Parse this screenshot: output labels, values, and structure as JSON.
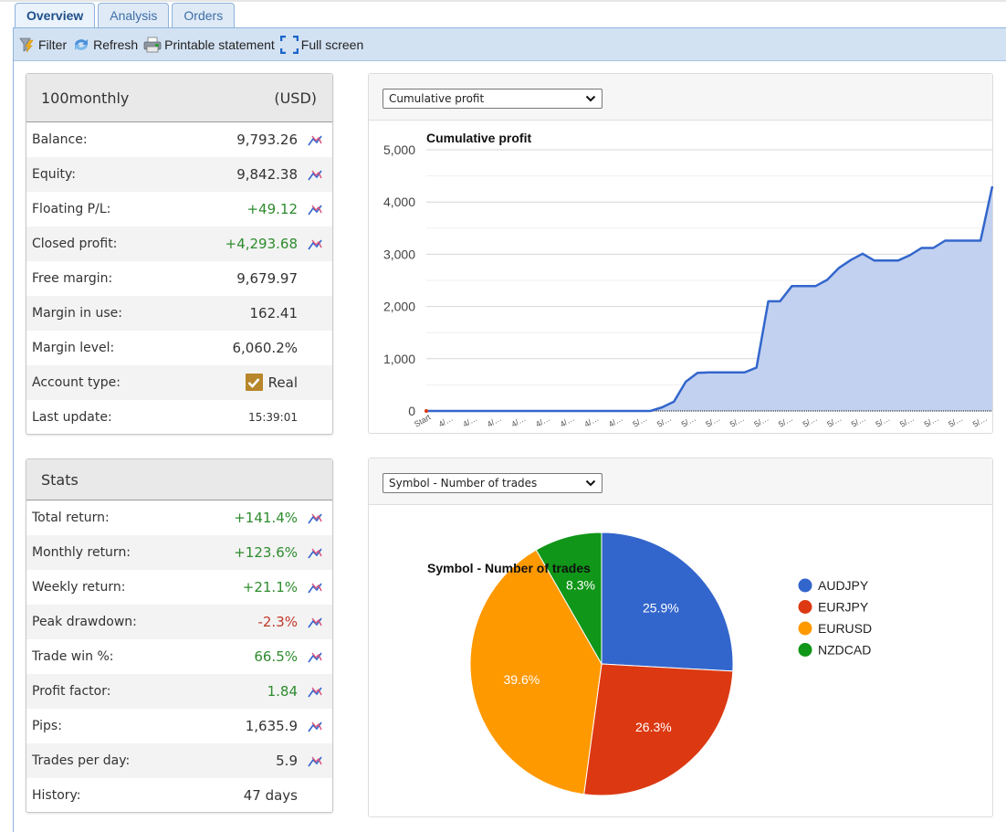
{
  "tabs": [
    {
      "label": "Overview",
      "active": true
    },
    {
      "label": "Analysis",
      "active": false
    },
    {
      "label": "Orders",
      "active": false
    }
  ],
  "toolbar": {
    "filter": {
      "label": "Filter",
      "icon": "filter-icon"
    },
    "refresh": {
      "label": "Refresh",
      "icon": "refresh-icon"
    },
    "print": {
      "label": "Printable statement",
      "icon": "printer-icon"
    },
    "fullscreen": {
      "label": "Full screen",
      "icon": "fullscreen-icon"
    }
  },
  "account": {
    "name": "100monthly",
    "currency": "(USD)",
    "rows": [
      {
        "label": "Balance:",
        "value": "9,793.26",
        "tone": "",
        "chart_icon": true
      },
      {
        "label": "Equity:",
        "value": "9,842.38",
        "tone": "",
        "chart_icon": true
      },
      {
        "label": "Floating P/L:",
        "value": "+49.12",
        "tone": "pos",
        "chart_icon": true
      },
      {
        "label": "Closed profit:",
        "value": "+4,293.68",
        "tone": "pos",
        "chart_icon": true
      },
      {
        "label": "Free margin:",
        "value": "9,679.97",
        "tone": "",
        "chart_icon": false
      },
      {
        "label": "Margin in use:",
        "value": "162.41",
        "tone": "",
        "chart_icon": false
      },
      {
        "label": "Margin level:",
        "value": "6,060.2%",
        "tone": "",
        "chart_icon": false
      },
      {
        "label": "Account type:",
        "value": "Real",
        "tone": "",
        "chart_icon": false,
        "checked": true
      },
      {
        "label": "Last update:",
        "value": "15:39:01",
        "tone": "small",
        "chart_icon": false
      }
    ]
  },
  "stats": {
    "title": "Stats",
    "rows": [
      {
        "label": "Total return:",
        "value": "+141.4%",
        "tone": "pos",
        "chart_icon": true
      },
      {
        "label": "Monthly return:",
        "value": "+123.6%",
        "tone": "pos",
        "chart_icon": true
      },
      {
        "label": "Weekly return:",
        "value": "+21.1%",
        "tone": "pos",
        "chart_icon": true
      },
      {
        "label": "Peak drawdown:",
        "value": "-2.3%",
        "tone": "neg",
        "chart_icon": true
      },
      {
        "label": "Trade win %:",
        "value": "66.5%",
        "tone": "pos",
        "chart_icon": true
      },
      {
        "label": "Profit factor:",
        "value": "1.84",
        "tone": "pos",
        "chart_icon": true
      },
      {
        "label": "Pips:",
        "value": "1,635.9",
        "tone": "",
        "chart_icon": true
      },
      {
        "label": "Trades per day:",
        "value": "5.9",
        "tone": "",
        "chart_icon": true
      },
      {
        "label": "History:",
        "value": "47 days",
        "tone": "",
        "chart_icon": false
      }
    ]
  },
  "profit_chart": {
    "selector_value": "Cumulative profit"
  },
  "pie_chart": {
    "selector_value": "Symbol - Number of trades"
  },
  "colors": {
    "line": "#3366cc",
    "area": "#c2d1f0",
    "audjpy": "#3366cc",
    "eurjpy": "#dc3912",
    "eurusd": "#ff9900",
    "nzdcad": "#109618"
  },
  "chart_data": [
    {
      "type": "area",
      "title": "Cumulative profit",
      "xlabel": "",
      "ylabel": "",
      "ylim": [
        0,
        5000
      ],
      "yticks": [
        0,
        1000,
        2000,
        3000,
        4000,
        5000
      ],
      "ytick_labels": [
        "0",
        "1,000",
        "2,000",
        "3,000",
        "4,000",
        "5,000"
      ],
      "grid": true,
      "x_tick_labels": [
        "Start",
        "4/…",
        "4/…",
        "4/…",
        "4/…",
        "4/…",
        "4/…",
        "4/…",
        "4/…",
        "5/…",
        "5/…",
        "5/…",
        "5/…",
        "5/…",
        "5/…",
        "5/…",
        "5/…",
        "5/…",
        "5/…",
        "5/…",
        "5/…",
        "5/…",
        "5/…",
        "5/…"
      ],
      "series": [
        {
          "name": "Cumulative profit",
          "values": [
            0,
            0,
            0,
            0,
            0,
            0,
            0,
            0,
            0,
            0,
            0,
            0,
            0,
            0,
            0,
            0,
            0,
            0,
            0,
            0,
            70,
            180,
            560,
            730,
            740,
            740,
            740,
            740,
            830,
            2100,
            2100,
            2390,
            2390,
            2390,
            2510,
            2740,
            2890,
            3010,
            2880,
            2880,
            2880,
            2980,
            3120,
            3120,
            3260,
            3260,
            3260,
            3260,
            4300
          ]
        }
      ]
    },
    {
      "type": "pie",
      "title": "Symbol - Number of trades",
      "legend": "right",
      "categories": [
        "AUDJPY",
        "EURJPY",
        "EURUSD",
        "NZDCAD"
      ],
      "values": [
        25.9,
        26.3,
        39.6,
        8.3
      ],
      "labels": [
        "25.9%",
        "26.3%",
        "39.6%",
        "8.3%"
      ]
    }
  ]
}
